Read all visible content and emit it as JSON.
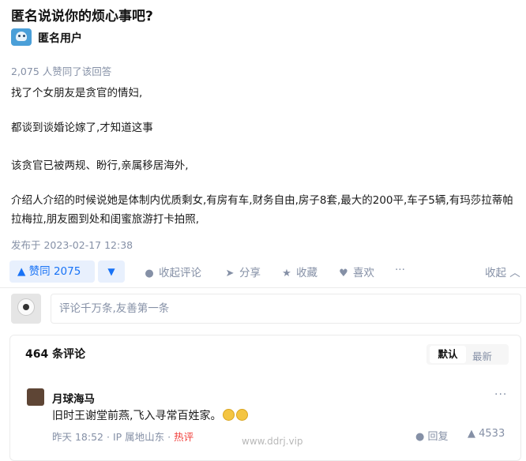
{
  "question": {
    "title": "匿名说说你的烦心事吧?"
  },
  "author": {
    "name": "匿名用户"
  },
  "answer": {
    "vote_summary": "2,075 人赞同了该回答",
    "paragraphs": [
      "找了个女朋友是贪官的情妇,",
      "都谈到谈婚论嫁了,才知道这事",
      "该贪官已被两规、盼行,亲属移居海外,",
      "介绍人介绍的时候说她是体制内优质剩女,有房有车,财务自由,房子8套,最大的200平,车子5辆,有玛莎拉蒂帕拉梅拉,朋友圈到处和闺蜜旅游打卡拍照,"
    ],
    "published": "发布于 2023-02-17 12:38"
  },
  "actions": {
    "upvote_label": "▲ 赞同 2075",
    "downvote_label": "▼",
    "comment_label": "收起评论",
    "share_label": "分享",
    "favorite_label": "收藏",
    "like_label": "喜欢",
    "more_label": "···",
    "collapse_label": "收起 ︿"
  },
  "comment_box": {
    "placeholder": "评论千万条,友善第一条"
  },
  "comments": {
    "count_label": "464 条评论",
    "sort_default": "默认",
    "sort_latest": "最新",
    "items": [
      {
        "author": "月球海马",
        "text": "旧时王谢堂前燕,飞入寻常百姓家。",
        "time": "昨天 18:52",
        "location": "IP 属地山东",
        "badge": "热评",
        "reply_label": "回复",
        "likes": "4533"
      }
    ]
  },
  "watermark": "www.ddrj.vip",
  "colors": {
    "accent": "#1772f6",
    "muted": "#8590a6",
    "hot": "#f1403c"
  }
}
